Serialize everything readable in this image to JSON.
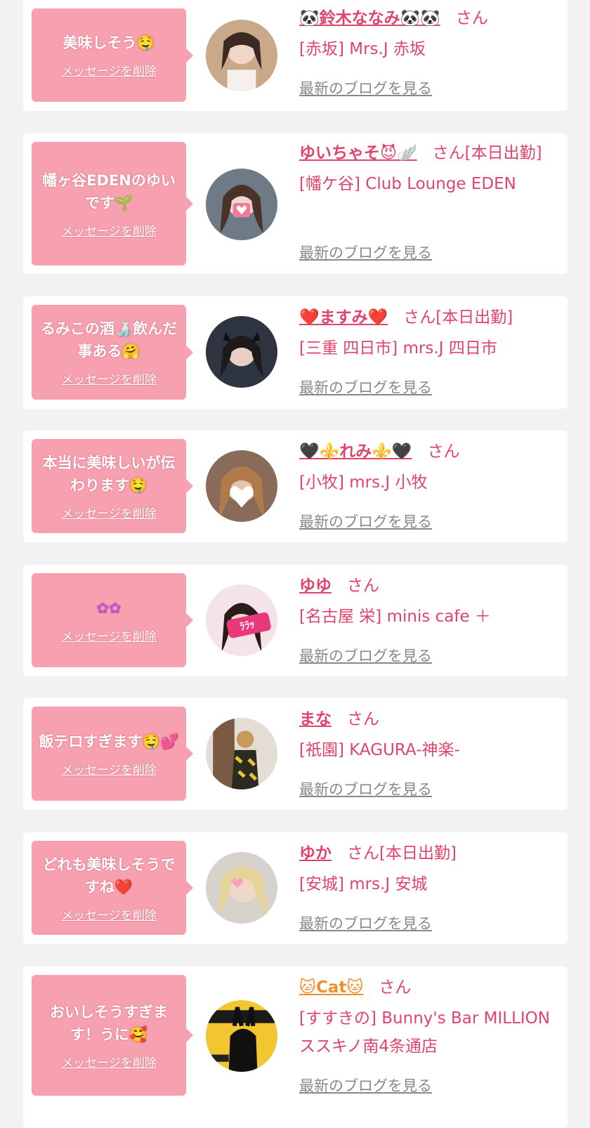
{
  "delete_label": "メッセージを削除",
  "blog_label": "最新のブログを見る",
  "accent_color": "#e0446a",
  "bubble_color": "#f7a1b0",
  "entries": [
    {
      "message": "美味しそう🤤",
      "name": "🐼鈴木ななみ🐼🐼",
      "honorific": "さん",
      "shop": "[赤坂] Mrs.J 赤坂"
    },
    {
      "message": "幡ヶ谷EDENのゆいです🌱",
      "name": "ゆいちゃそ😈🪽",
      "honorific": "さん[本日出勤]",
      "shop": "[幡ケ谷] Club Lounge EDEN"
    },
    {
      "message": "るみこの酒🍶飲んだ事ある🤗",
      "name": "❤️ますみ❤️",
      "honorific": "さん[本日出勤]",
      "shop": "[三重 四日市] mrs.J 四日市"
    },
    {
      "message": "本当に美味しいが伝わります🤤",
      "name": "🖤⚜️れみ⚜️🖤",
      "honorific": "さん",
      "shop": "[小牧] mrs.J 小牧"
    },
    {
      "message": "✿✿",
      "name": "ゆゆ",
      "honorific": "さん",
      "shop": "[名古屋 栄] minis cafe ＋"
    },
    {
      "message": "飯テロすぎます🤤💕",
      "name": "まな",
      "honorific": "さん",
      "shop": "[祇園] KAGURA-神楽-"
    },
    {
      "message": "どれも美味しそうですね❤️",
      "name": "ゆか",
      "honorific": "さん[本日出勤]",
      "shop": "[安城] mrs.J 安城"
    },
    {
      "message": "おいしそうすぎます！うに🥰",
      "name": "🐱Cat🐱",
      "honorific": "さん",
      "shop": "[すすきの] Bunny's Bar MILLION ススキノ南4条通店"
    }
  ]
}
